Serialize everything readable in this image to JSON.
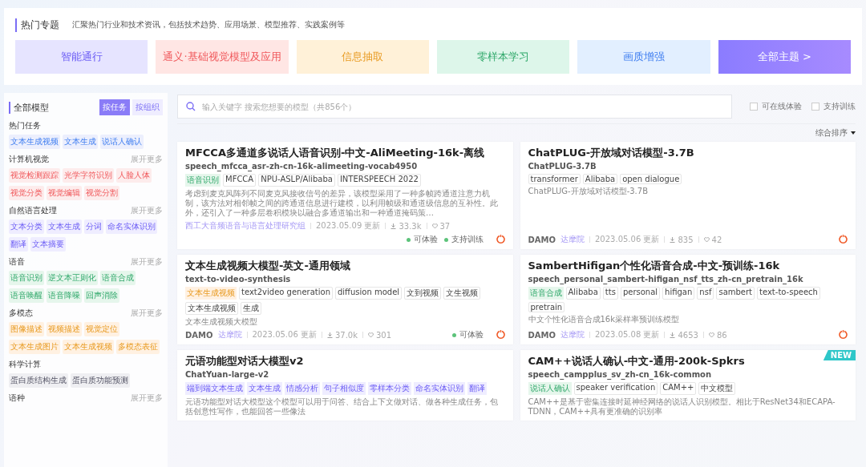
{
  "banner": {
    "title": "热门专题",
    "subtitle": "汇聚热门行业和技术资讯，包括技术趋势、应用场景、模型推荐、实践案例等",
    "tiles": [
      {
        "label": "智能通行",
        "kind": "violet"
      },
      {
        "label": "通义·基础视觉模型及应用",
        "kind": "red"
      },
      {
        "label": "信息抽取",
        "kind": "amber"
      },
      {
        "label": "零样本学习",
        "kind": "green"
      },
      {
        "label": "画质增强",
        "kind": "blue"
      },
      {
        "label": "全部主题 >",
        "kind": "all"
      }
    ]
  },
  "sidebar": {
    "title": "全部模型",
    "toggles": [
      {
        "label": "按任务",
        "selected": true
      },
      {
        "label": "按组织",
        "selected": false
      }
    ],
    "sections": [
      {
        "title": "热门任务",
        "kind": "blue",
        "tags": [
          "文本生成视频",
          "文本生成",
          "说话人确认"
        ]
      },
      {
        "title": "计算机视觉",
        "more": "展开更多",
        "kind": "red",
        "tags": [
          "视觉检测跟踪",
          "光学字符识别",
          "人脸人体",
          "视觉分类",
          "视觉编辑",
          "视觉分割"
        ]
      },
      {
        "title": "自然语言处理",
        "more": "展开更多",
        "kind": "violet",
        "tags": [
          "文本分类",
          "文本生成",
          "分词",
          "命名实体识别",
          "翻译",
          "文本摘要"
        ]
      },
      {
        "title": "语音",
        "more": "展开更多",
        "kind": "green",
        "tags": [
          "语音识别",
          "逆文本正则化",
          "语音合成",
          "语音唤醒",
          "语音降噪",
          "回声消除"
        ]
      },
      {
        "title": "多模态",
        "more": "展开更多",
        "kind": "amber",
        "tags": [
          "图像描述",
          "视频描述",
          "视觉定位",
          "文本生成图片",
          "文本生成视频",
          "多模态表征"
        ]
      },
      {
        "title": "科学计算",
        "kind": "grey",
        "tags": [
          "蛋白质结构生成",
          "蛋白质功能预测"
        ]
      },
      {
        "title": "语种",
        "more": "展开更多"
      }
    ]
  },
  "search": {
    "placeholder": "输入关键字 搜索您想要的模型（共856个）"
  },
  "filters": [
    {
      "label": "可在线体验",
      "checked": false
    },
    {
      "label": "支持训练",
      "checked": false
    }
  ],
  "sort": {
    "label": "综合排序"
  },
  "cards": [
    {
      "title": "MFCCA多通道多说话人语音识别-中文-AliMeeting-16k-离线",
      "id": "speech_mfcca_asr-zh-cn-16k-alimeeting-vocab4950",
      "task_tags": [
        {
          "label": "语音识别",
          "kind": "green"
        }
      ],
      "tags": [
        "MFCCA",
        "NPU-ASLP/Alibaba",
        "INTERSPEECH 2022"
      ],
      "description": "考虑到麦克风阵列不同麦克风接收信号的差异，该模型采用了一种多帧跨通道注意力机制，该方法对相邻帧之间的跨通道信息进行建模，以利用帧级和通道级信息的互补性。此外，还引入了一种多层卷积模块以融合多通道输出和一种通道掩码策…",
      "org": "西工大音频语音与语言处理研究组",
      "date": "2023.05.09 更新",
      "downloads": "33.3k",
      "likes": "37",
      "badges": [
        "可体验",
        "支持训练"
      ],
      "new": false
    },
    {
      "title": "ChatPLUG-开放域对话模型-3.7B",
      "id": "ChatPLUG-3.7B",
      "tags": [
        "transformer",
        "Alibaba",
        "open dialogue"
      ],
      "description": "ChatPLUG-开放域对话模型-3.7B",
      "org_logo": "DAMO",
      "org": "达摩院",
      "date": "2023.05.06 更新",
      "downloads": "835",
      "likes": "42",
      "new": false
    },
    {
      "title": "文本生成视频大模型-英文-通用领域",
      "id": "text-to-video-synthesis",
      "task_tags": [
        {
          "label": "文本生成视频",
          "kind": "amber"
        }
      ],
      "tags": [
        "text2video generation",
        "diffusion model",
        "文到视频",
        "文生视频",
        "文本生成视频",
        "生成"
      ],
      "description": "文本生成视频大模型",
      "org_logo": "DAMO",
      "org": "达摩院",
      "date": "2023.05.06 更新",
      "downloads": "37.0k",
      "likes": "301",
      "badges": [
        "可体验"
      ],
      "new": false
    },
    {
      "title": "SambertHifigan个性化语音合成-中文-预训练-16k",
      "id": "speech_personal_sambert-hifigan_nsf_tts_zh-cn_pretrain_16k",
      "task_tags": [
        {
          "label": "语音合成",
          "kind": "green"
        }
      ],
      "tags": [
        "Alibaba",
        "tts",
        "personal",
        "hifigan",
        "nsf",
        "sambert",
        "text-to-speech",
        "pretrain"
      ],
      "description": "中文个性化语音合成16k采样率预训练模型",
      "org_logo": "DAMO",
      "org": "达摩院",
      "date": "2023.05.08 更新",
      "downloads": "4653",
      "likes": "86",
      "new": false
    },
    {
      "title": "元语功能型对话大模型v2",
      "id": "ChatYuan-large-v2",
      "task_tags": [
        {
          "label": "端到端文本生成",
          "kind": "violet"
        },
        {
          "label": "文本生成",
          "kind": "violet"
        },
        {
          "label": "情感分析",
          "kind": "violet"
        },
        {
          "label": "句子相似度",
          "kind": "violet"
        },
        {
          "label": "零样本分类",
          "kind": "violet"
        },
        {
          "label": "命名实体识别",
          "kind": "violet"
        },
        {
          "label": "翻译",
          "kind": "violet"
        }
      ],
      "description": "元语功能型对话大模型这个模型可以用于问答、结合上下文做对话、做各种生成任务，包括创意性写作，也能回答一些像法",
      "new": false
    },
    {
      "title": "CAM++说话人确认-中文-通用-200k-Spkrs",
      "id": "speech_campplus_sv_zh-cn_16k-common",
      "task_tags": [
        {
          "label": "说话人确认",
          "kind": "green"
        }
      ],
      "tags": [
        "speaker verification",
        "CAM++",
        "中文模型"
      ],
      "description": "CAM++是基于密集连接时延神经网络的说话人识别模型。相比于ResNet34和ECAPA-TDNN，CAM++具有更准确的识别率",
      "new": true,
      "new_label": "NEW"
    }
  ]
}
